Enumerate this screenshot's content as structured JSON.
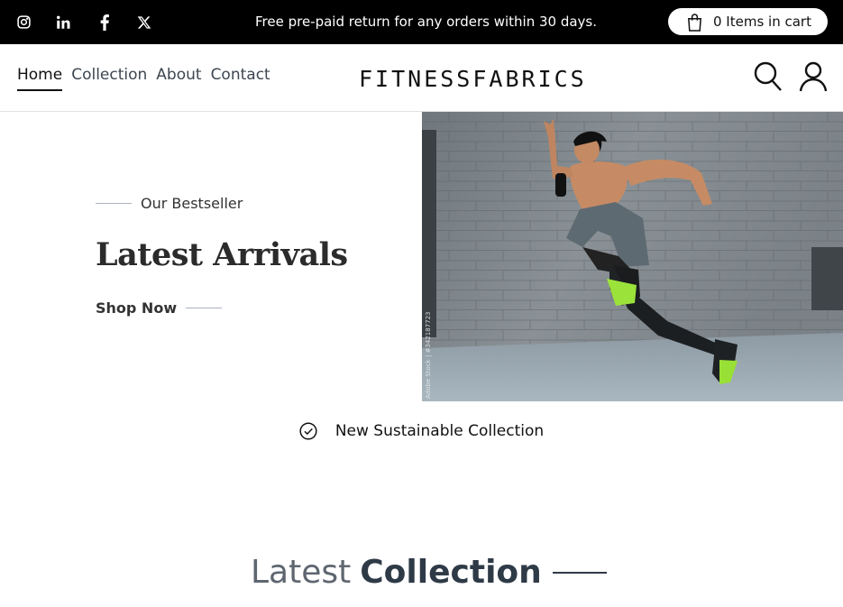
{
  "topbar": {
    "social": [
      {
        "icon": "instagram-icon"
      },
      {
        "icon": "linkedin-icon"
      },
      {
        "icon": "facebook-icon"
      },
      {
        "icon": "x-twitter-icon"
      }
    ],
    "announcement": "Free pre-paid return for any orders within 30 days.",
    "cart_label": "0 Items in cart",
    "cart_icon": "shopping-bag-icon"
  },
  "header": {
    "nav": [
      {
        "label": "Home",
        "active": true
      },
      {
        "label": "Collection",
        "active": false
      },
      {
        "label": "About",
        "active": false
      },
      {
        "label": "Contact",
        "active": false
      }
    ],
    "logo": "FITNESSFABRICS",
    "icons": [
      "search-icon",
      "user-icon"
    ]
  },
  "hero": {
    "eyebrow": "Our Bestseller",
    "title": "Latest Arrivals",
    "cta": "Shop Now",
    "image_watermark": "Adobe Stock | #342187723"
  },
  "feature": {
    "icon": "check-circle-icon",
    "text": "New Sustainable Collection"
  },
  "section": {
    "title_light": "Latest",
    "title_bold": "Collection"
  },
  "colors": {
    "topbar_bg": "#000000",
    "text_dark": "#2f3a47",
    "accent_line": "#aab2bd"
  }
}
